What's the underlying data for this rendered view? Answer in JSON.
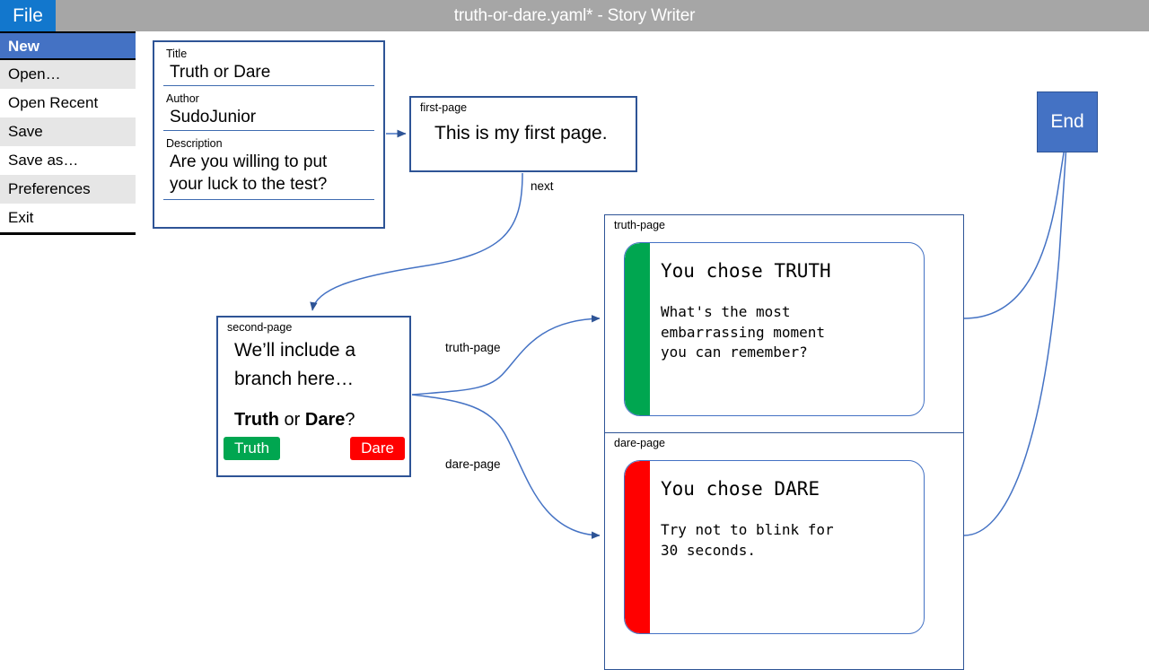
{
  "window": {
    "title": "truth-or-dare.yaml* - Story Writer",
    "menubar": {
      "file_label": "File"
    }
  },
  "file_menu": {
    "items": [
      {
        "label": "New",
        "selected": true
      },
      {
        "label": "Open…",
        "selected": false
      },
      {
        "label": "Open Recent",
        "selected": false
      },
      {
        "label": "Save",
        "selected": false
      },
      {
        "label": "Save as…",
        "selected": false
      },
      {
        "label": "Preferences",
        "selected": false
      },
      {
        "label": "Exit",
        "selected": false
      }
    ]
  },
  "story": {
    "metadata": {
      "title_label": "Title",
      "title_value": "Truth or Dare",
      "author_label": "Author",
      "author_value": "SudoJunior",
      "description_label": "Description",
      "description_value": "Are you willing to put\nyour luck to the test?"
    },
    "pages": {
      "first": {
        "id": "first-page",
        "text": "This is my first page."
      },
      "second": {
        "id": "second-page",
        "text": "We’ll include a\nbranch here…",
        "prompt_prefix": "Truth",
        "prompt_middle": " or ",
        "prompt_suffix": "Dare",
        "prompt_end": "?",
        "buttons": [
          {
            "label": "Truth",
            "color": "#00a650"
          },
          {
            "label": "Dare",
            "color": "#ff0000"
          }
        ]
      },
      "truth": {
        "id": "truth-page",
        "accent_color": "#00a650",
        "heading": "You chose TRUTH",
        "body": "What's the most\nembarrassing moment\nyou can remember?"
      },
      "dare": {
        "id": "dare-page",
        "accent_color": "#ff0000",
        "heading": "You chose DARE",
        "body": "Try not to blink for\n30 seconds."
      }
    },
    "end_node": {
      "label": "End"
    },
    "edges": [
      {
        "from": "metadata",
        "to": "first-page",
        "label": ""
      },
      {
        "from": "first-page",
        "to": "second-page",
        "label": "next"
      },
      {
        "from": "second-page",
        "to": "truth-page",
        "label": "truth-page"
      },
      {
        "from": "second-page",
        "to": "dare-page",
        "label": "dare-page"
      },
      {
        "from": "truth-page",
        "to": "End",
        "label": ""
      },
      {
        "from": "dare-page",
        "to": "End",
        "label": ""
      }
    ]
  },
  "colors": {
    "titlebar": "#a6a6a6",
    "file_tab": "#1277cd",
    "menu_selected": "#4472c4",
    "node_border": "#2e5496",
    "edge": "#4472c4"
  }
}
